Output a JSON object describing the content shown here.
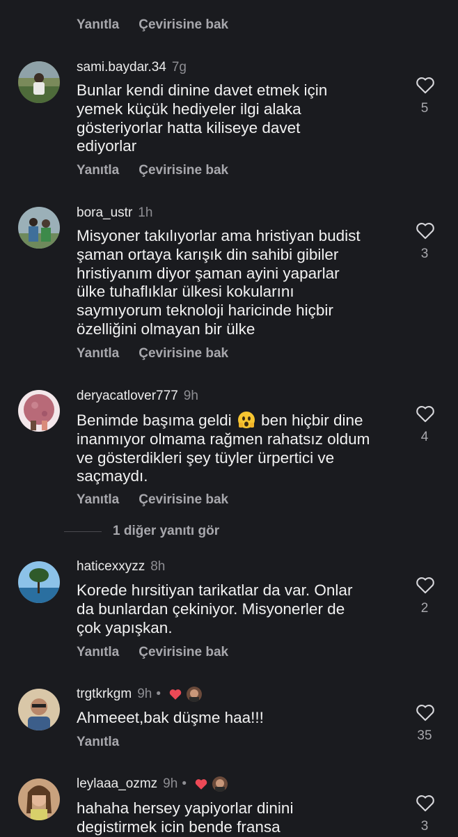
{
  "actions": {
    "reply": "Yanıtla",
    "translate": "Çevirisine bak"
  },
  "top": {
    "reply": "Yanıtla",
    "translate": "Çevirisine bak"
  },
  "comments": [
    {
      "username": "sami.baydar.34",
      "time": "7g",
      "lines": [
        "Bunlar kendi dinine davet etmek için",
        "yemek küçük hediyeler ilgi alaka",
        "gösteriyorlar hatta kiliseye davet",
        "ediyorlar"
      ],
      "likes": "5"
    },
    {
      "username": "bora_ustr",
      "time": "1h",
      "lines": [
        "Misyoner takılıyorlar ama hristiyan budist",
        "şaman ortaya karışık din sahibi gibiler",
        "hristiyanım diyor şaman ayini yaparlar",
        "ülke tuhaflıklar ülkesi kokularını",
        "saymıyorum teknoloji haricinde hiçbir",
        "özelliğini olmayan bir ülke"
      ],
      "likes": "3"
    },
    {
      "username": "deryacatlover777",
      "time": "9h",
      "line1_before": "Benimde başıma geldi",
      "line1_after": "ben hiçbir dine",
      "lines": [
        "inanmıyor olmama rağmen rahatsız oldum",
        "ve gösterdikleri şey tüyler ürpertici ve",
        "saçmaydı."
      ],
      "likes": "4",
      "emoji": "scared-face-emoji"
    },
    {
      "username": "haticexxyzz",
      "time": "8h",
      "lines": [
        "Korede hırsitiyan tarikatlar da var. Onlar",
        "da bunlardan çekiniyor. Misyonerler de",
        "çok yapışkan."
      ],
      "likes": "2"
    },
    {
      "username": "trgtkrkgm",
      "time": "9h",
      "dot": "•",
      "lines": [
        "Ahmeeet,bak düşme haa!!!"
      ],
      "likes": "35"
    },
    {
      "username": "leylaaa_ozmz",
      "time": "9h",
      "dot": "•",
      "lines": [
        "hahaha hersey yapiyorlar dinini",
        "degistirmek icin bende fransa"
      ],
      "likes": "3"
    }
  ],
  "more_replies": "1 diğer yanıtı gör",
  "colors": {
    "background": "#1a1b1f",
    "text": "#f2f2f2",
    "muted": "#a8a8ad",
    "heart": "#ed4956"
  }
}
